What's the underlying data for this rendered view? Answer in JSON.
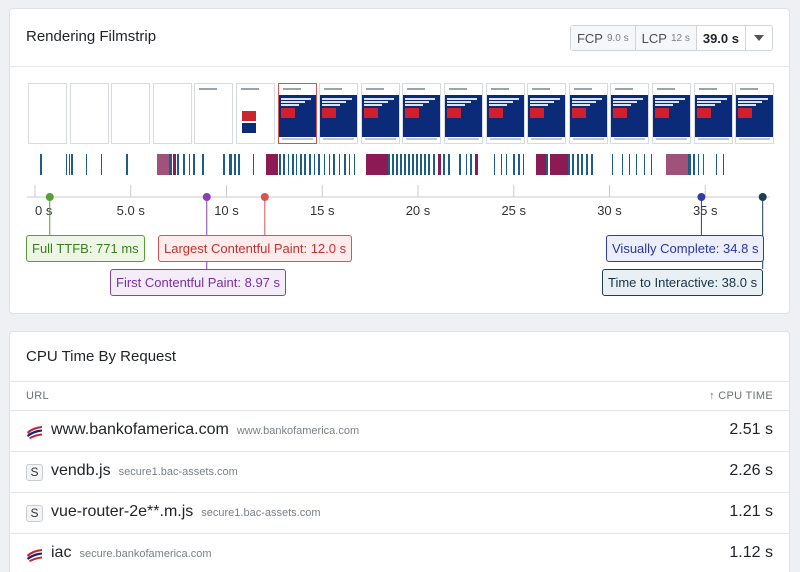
{
  "filmstrip_card": {
    "title": "Rendering Filmstrip",
    "metrics": {
      "fcp_label": "FCP",
      "fcp_value": "9.0 s",
      "lcp_label": "LCP",
      "lcp_value": "12 s",
      "selected_value": "39.0 s"
    },
    "axis_ticks": [
      "0 s",
      "5.0 s",
      "10 s",
      "15 s",
      "20 s",
      "25 s",
      "30 s",
      "35 s"
    ],
    "markers": {
      "ttfb": "Full TTFB: 771 ms",
      "fcp": "First Contentful Paint: 8.97 s",
      "lcp": "Largest Contentful Paint: 12.0 s",
      "vc": "Visually Complete: 34.8 s",
      "tti": "Time to Interactive: 38.0 s"
    },
    "colors": {
      "ttfb": "#57a033",
      "fcp": "#8a3fb0",
      "lcp": "#d9534f",
      "vc": "#2f3fa8",
      "tti": "#1c3d52",
      "bar_teal": "#1c5e86",
      "bar_magenta": "#8b1a55",
      "bar_pink": "#a0527b"
    }
  },
  "cpu_card": {
    "title": "CPU Time By Request",
    "col_url": "URL",
    "col_cpu": "↑ CPU TIME",
    "rows": [
      {
        "name": "www.bankofamerica.com",
        "host": "www.bankofamerica.com",
        "time": "2.51 s",
        "icon": "boa-flag-icon"
      },
      {
        "name": "vendb.js",
        "host": "secure1.bac-assets.com",
        "time": "2.26 s",
        "icon": "script-icon",
        "icon_text": "S"
      },
      {
        "name": "vue-router-2e**.m.js",
        "host": "secure1.bac-assets.com",
        "time": "1.21 s",
        "icon": "script-icon",
        "icon_text": "S"
      },
      {
        "name": "iac",
        "host": "secure.bankofamerica.com",
        "time": "1.12 s",
        "icon": "boa-flag-icon"
      }
    ]
  }
}
